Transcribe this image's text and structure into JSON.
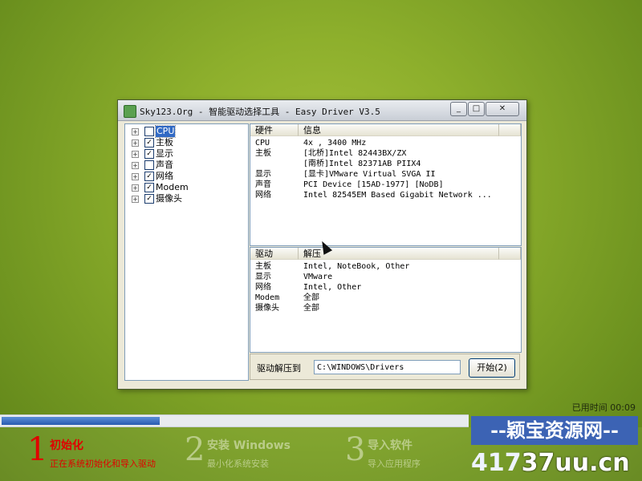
{
  "window": {
    "title": "Sky123.Org - 智能驱动选择工具 - Easy Driver V3.5",
    "min_symbol": "_",
    "max_symbol": "□",
    "close_symbol": "✕"
  },
  "tree": {
    "items": [
      {
        "label": "CPU",
        "checked": false,
        "selected": true
      },
      {
        "label": "主板",
        "checked": true
      },
      {
        "label": "显示",
        "checked": true
      },
      {
        "label": "声音",
        "checked": false
      },
      {
        "label": "网络",
        "checked": true
      },
      {
        "label": "Modem",
        "checked": true
      },
      {
        "label": "摄像头",
        "checked": true
      }
    ],
    "expander_symbol": "+",
    "check_symbol": "✓"
  },
  "hardware": {
    "col1": "硬件",
    "col2": "信息",
    "rows": [
      {
        "name": "CPU",
        "info": "4x , 3400 MHz"
      },
      {
        "name": "主板",
        "info": "[北桥]Intel 82443BX/ZX"
      },
      {
        "name": "",
        "info": "[南桥]Intel 82371AB PIIX4"
      },
      {
        "name": "显示",
        "info": "[显卡]VMware Virtual SVGA II"
      },
      {
        "name": "声音",
        "info": "PCI Device [15AD-1977] [NoDB]"
      },
      {
        "name": "网络",
        "info": "Intel 82545EM Based Gigabit Network ..."
      }
    ]
  },
  "drivers": {
    "col1": "驱动",
    "col2": "解压",
    "rows": [
      {
        "name": "主板",
        "info": "Intel, NoteBook, Other"
      },
      {
        "name": "显示",
        "info": "VMware"
      },
      {
        "name": "网络",
        "info": "Intel, Other"
      },
      {
        "name": "Modem",
        "info": "全部"
      },
      {
        "name": "摄像头",
        "info": "全部"
      }
    ]
  },
  "extract": {
    "label": "驱动解压到",
    "path": "C:\\WINDOWS\\Drivers",
    "start_button": "开始(2)"
  },
  "status": {
    "elapsed": "已用时间 00:09",
    "progress": 0.34
  },
  "steps": [
    {
      "num": "1",
      "title": "初始化",
      "sub": "正在系统初始化和导入驱动"
    },
    {
      "num": "2",
      "title": "安装 Windows",
      "sub": "最小化系统安装"
    },
    {
      "num": "3",
      "title": "导入软件",
      "sub": "导入应用程序"
    }
  ],
  "watermark": {
    "line1": "--颖宝资源网--",
    "line2a": "417",
    "line2b": "37uu.cn"
  },
  "colors": {
    "accent_step": "#e00000",
    "selection": "#316ac5",
    "progress": "#2a5bb0"
  }
}
